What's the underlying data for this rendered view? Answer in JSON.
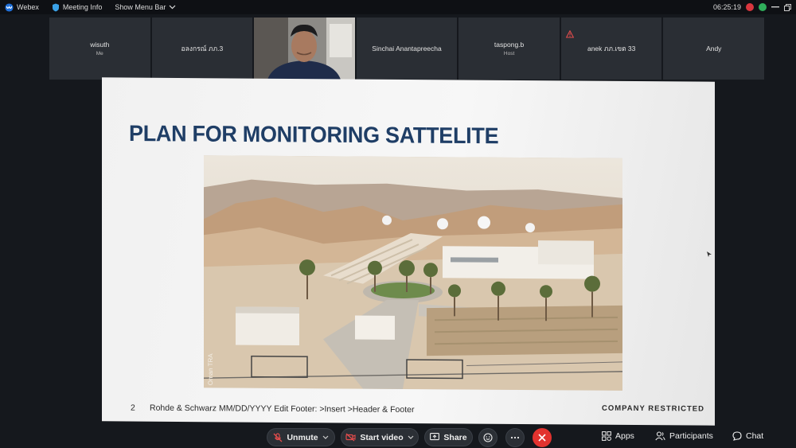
{
  "topbar": {
    "app_name": "Webex",
    "meeting_info": "Meeting Info",
    "show_menu_bar": "Show Menu Bar",
    "clock": "06:25:19"
  },
  "participants": [
    {
      "name": "wisuth",
      "sub": "Me"
    },
    {
      "name": "อลงกรณ์ ภภ.3",
      "sub": ""
    },
    {
      "name": "",
      "sub": "",
      "video": true
    },
    {
      "name": "Sinchai Anantapreecha",
      "sub": ""
    },
    {
      "name": "taspong.b",
      "sub": "Host"
    },
    {
      "name": "anek ภภ.เขต 33",
      "sub": "",
      "warning": true
    },
    {
      "name": "Andy",
      "sub": ""
    }
  ],
  "slide": {
    "title": "PLAN FOR MONITORING SATTELITE",
    "photo_credit": "Oman TRA",
    "page_number": "2",
    "footer_text": "Rohde & Schwarz  MM/DD/YYYY Edit Footer: >Insert >Header & Footer",
    "restricted_label": "COMPANY RESTRICTED"
  },
  "controls": {
    "unmute": "Unmute",
    "start_video": "Start video",
    "share": "Share",
    "apps": "Apps",
    "participants": "Participants",
    "chat": "Chat"
  },
  "colors": {
    "title_blue": "#1f3e66",
    "end_call_red": "#e2332f",
    "app_bg": "#15181d"
  },
  "icons": [
    "webex-logo-icon",
    "info-icon",
    "chevron-down-icon",
    "warning-icon",
    "mic-muted-icon",
    "video-off-icon",
    "share-icon",
    "emoji-icon",
    "more-icon",
    "end-call-icon",
    "apps-icon",
    "participants-icon",
    "chat-icon"
  ]
}
